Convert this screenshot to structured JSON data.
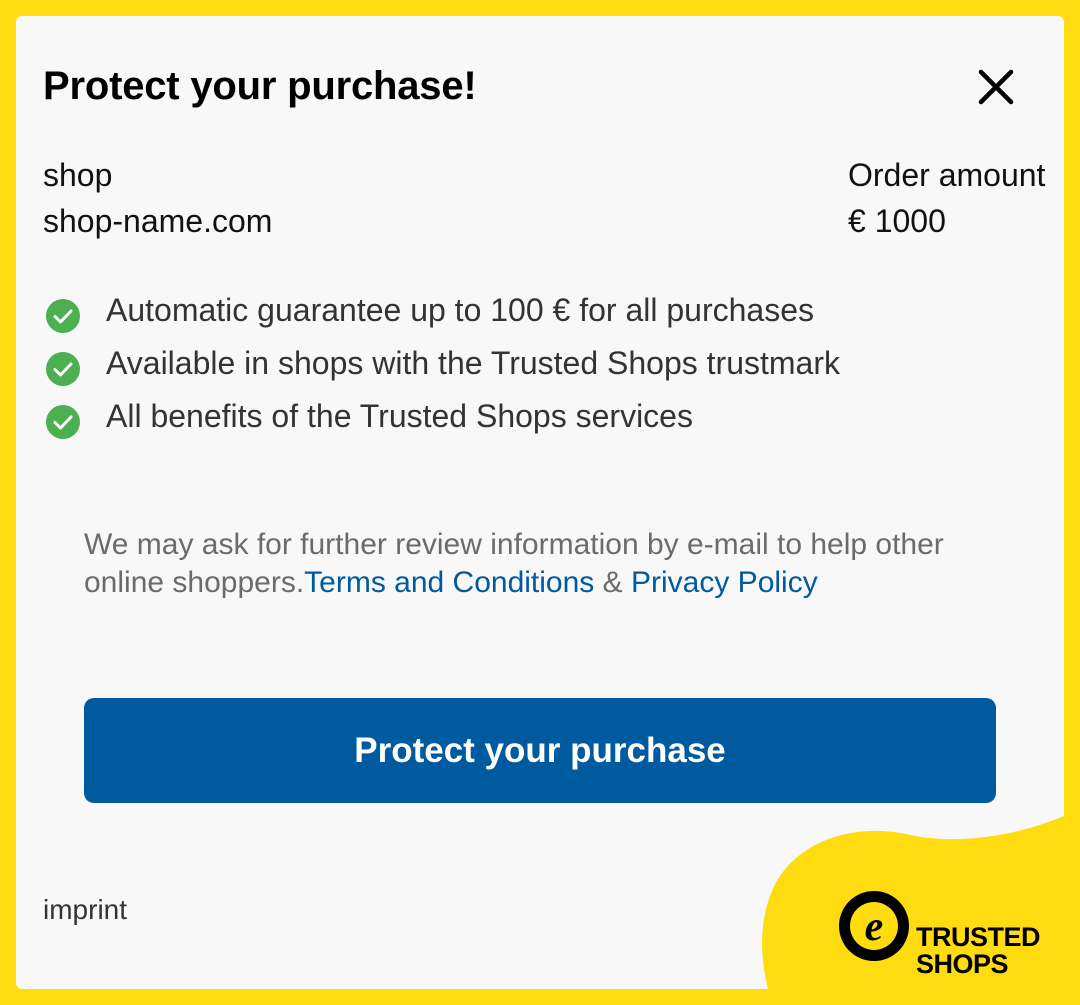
{
  "dialog": {
    "title": "Protect your purchase!"
  },
  "shop": {
    "label": "shop",
    "name": "shop-name.com"
  },
  "order": {
    "label": "Order amount",
    "amount": "€ 1000"
  },
  "benefits": [
    {
      "text": "Automatic guarantee up to 100 € for all purchases",
      "icon": "check-circle-icon"
    },
    {
      "text": "Available in shops with the Trusted Shops trustmark",
      "icon": "check-circle-icon"
    },
    {
      "text": "All benefits of the Trusted Shops services",
      "icon": "check-circle-icon"
    }
  ],
  "note": {
    "text": "We may ask for further review information by e-mail to help other online shoppers.",
    "terms_link": "Terms and Conditions",
    "separator": " & ",
    "privacy_link": "Privacy Policy"
  },
  "cta": {
    "label": "Protect your purchase"
  },
  "footer": {
    "imprint": "imprint",
    "logo_line1": "TRUSTED",
    "logo_line2": "SHOPS"
  },
  "colors": {
    "brand_yellow": "#ffdc0f",
    "primary_blue": "#005aa0",
    "check_green": "#4caf50"
  }
}
